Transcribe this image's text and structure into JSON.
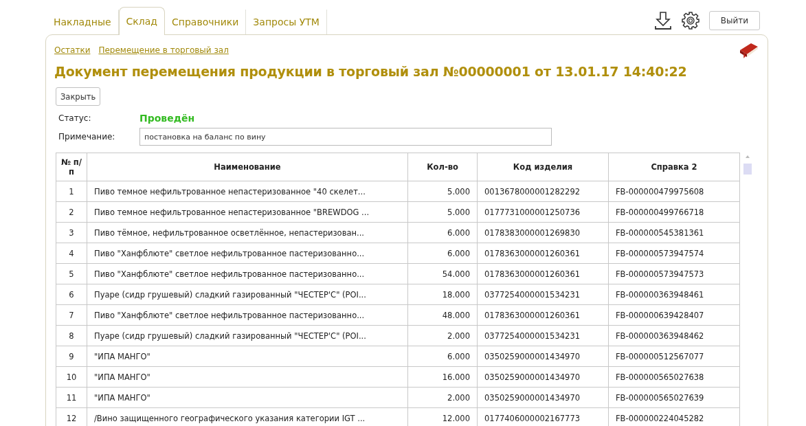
{
  "tabs": [
    {
      "label": "Накладные",
      "selected": false
    },
    {
      "label": "Склад",
      "selected": true
    },
    {
      "label": "Справочники",
      "selected": false
    },
    {
      "label": "Запросы УТМ",
      "selected": false
    }
  ],
  "logout_button": "Выйти",
  "breadcrumbs": [
    "Остатки",
    "Перемещение в торговый зал"
  ],
  "title": "Документ перемещения продукции в торговый зал №00000001 от 13.01.17 14:40:22",
  "close_button": "Закрыть",
  "status": {
    "label": "Статус:",
    "value": "Проведён"
  },
  "note": {
    "label": "Примечание:",
    "value": "постановка на баланс по вину"
  },
  "table": {
    "columns": [
      "№ п/п",
      "Наименование",
      "Кол-во",
      "Код изделия",
      "Справка 2"
    ],
    "rows": [
      [
        "1",
        "Пиво темное нефильтрованное непастеризованное \"40 скелет...",
        "5.000",
        "0013678000001282292",
        "FB-000000479975608"
      ],
      [
        "2",
        "Пиво темное нефильтрованное непастеризованное \"BREWDOG ...",
        "5.000",
        "0177731000001250736",
        "FB-000000499766718"
      ],
      [
        "3",
        "Пиво тёмное, нефильтрованное осветлённое, непастеризован...",
        "6.000",
        "0178383000001269830",
        "FB-000000545381361"
      ],
      [
        "4",
        "Пиво \"Ханфблюте\" светлое нефильтрованное пастеризованно...",
        "6.000",
        "0178363000001260361",
        "FB-000000573947574"
      ],
      [
        "5",
        "Пиво \"Ханфблюте\" светлое нефильтрованное пастеризованно...",
        "54.000",
        "0178363000001260361",
        "FB-000000573947573"
      ],
      [
        "6",
        "Пуаре (сидр грушевый) сладкий газированный \"ЧЕСТЕР'С\" (POI...",
        "18.000",
        "0377254000001534231",
        "FB-000000363948461"
      ],
      [
        "7",
        "Пиво \"Ханфблюте\" светлое нефильтрованное пастеризованно...",
        "48.000",
        "0178363000001260361",
        "FB-000000639428407"
      ],
      [
        "8",
        "Пуаре (сидр грушевый) сладкий газированный \"ЧЕСТЕР'С\" (POI...",
        "2.000",
        "0377254000001534231",
        "FB-000000363948462"
      ],
      [
        "9",
        "\"ИПА МАНГО\"",
        "6.000",
        "0350259000001434970",
        "FB-000000512567077"
      ],
      [
        "10",
        "\"ИПА МАНГО\"",
        "16.000",
        "0350259000001434970",
        "FB-000000565027638"
      ],
      [
        "11",
        "\"ИПА МАНГО\"",
        "2.000",
        "0350259000001434970",
        "FB-000000565027639"
      ],
      [
        "12",
        "/Вино защищенного географического указания категории IGT ...",
        "12.000",
        "0177406000002167773",
        "FB-000000224045282"
      ]
    ]
  }
}
